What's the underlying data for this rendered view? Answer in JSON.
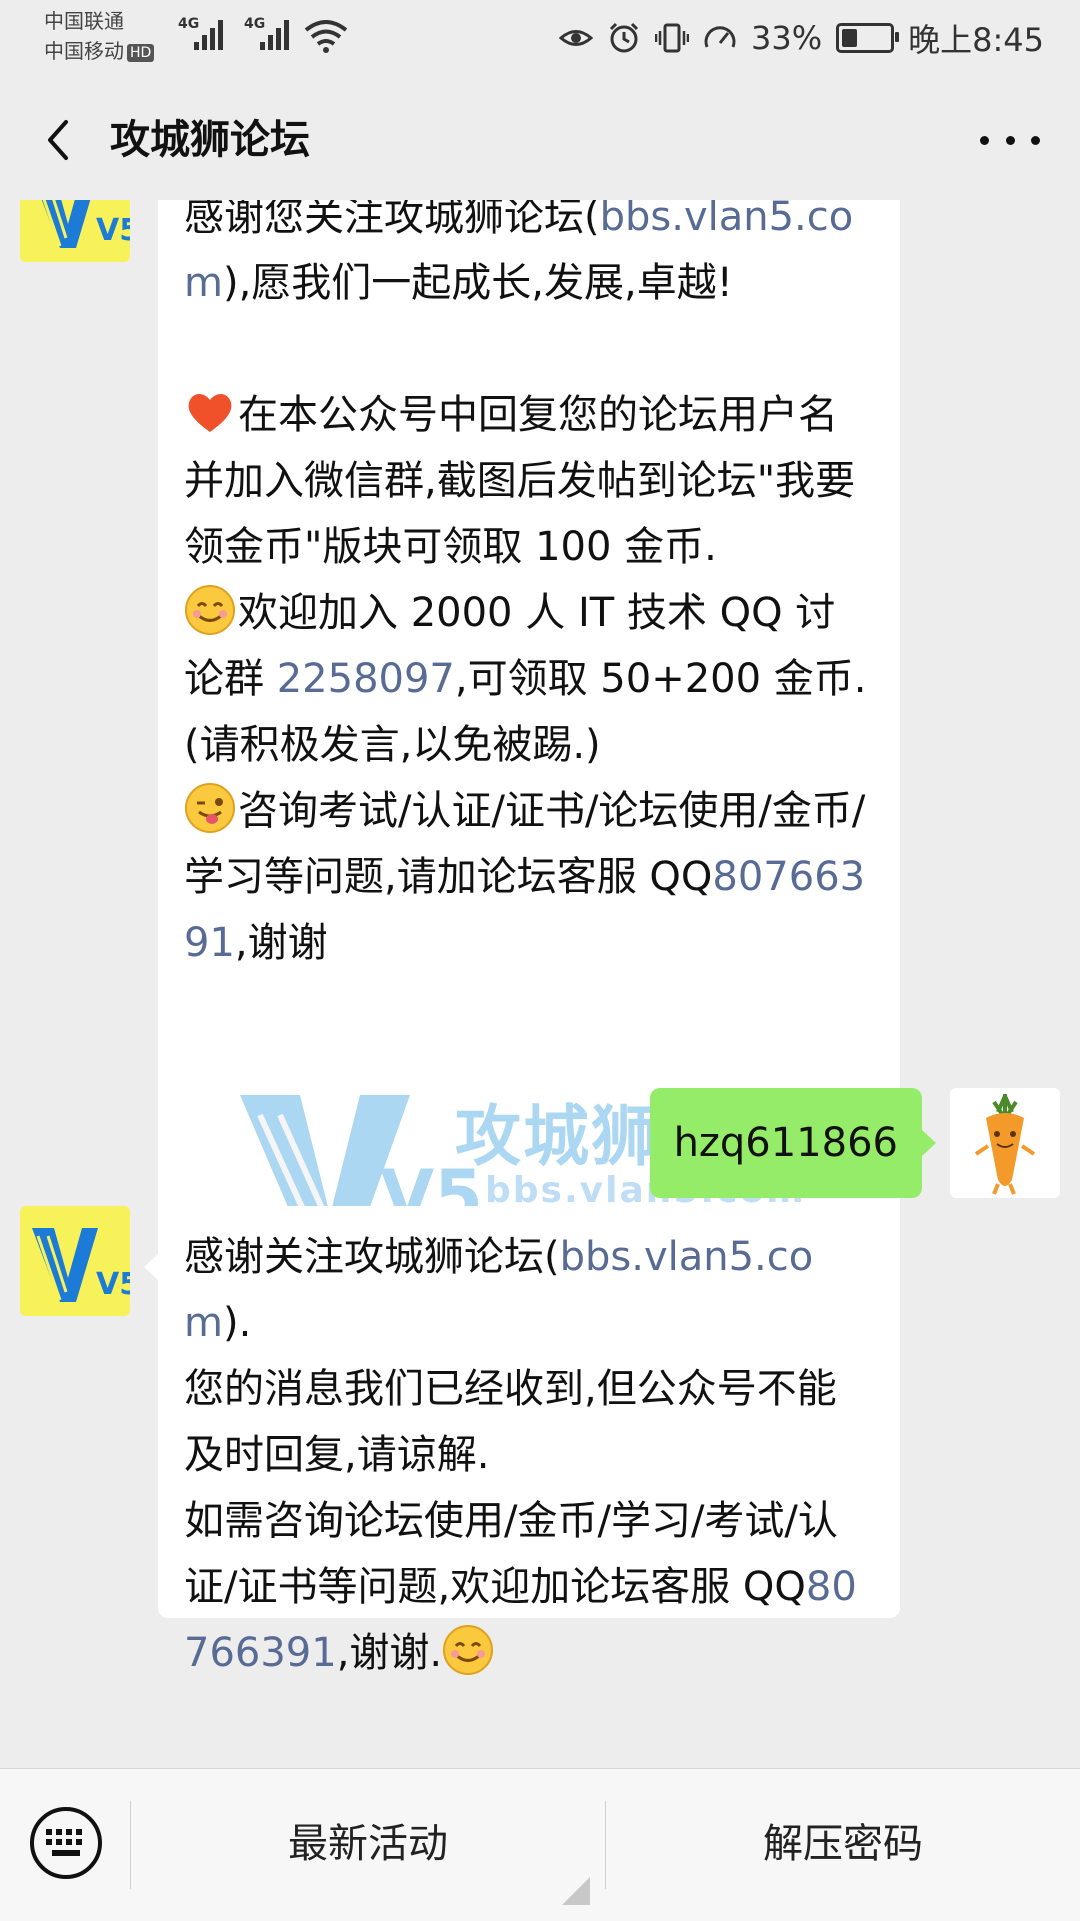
{
  "status_bar": {
    "carrier_1": "中国联通",
    "carrier_2": "中国移动",
    "hd_badge": "HD",
    "network_1": "4G",
    "network_2": "4G",
    "battery_percent": "33%",
    "battery_level": 0.33,
    "time": "晚上8:45"
  },
  "header": {
    "title": "攻城狮论坛"
  },
  "messages": {
    "m1": {
      "p1_text": "感谢您关注攻城狮论坛(",
      "p1_link": "bbs.vlan5.com",
      "p1_tail": "),愿我们一起成长,发展,卓越!",
      "p2_text": "在本公众号中回复您的论坛用户名并加入微信群,截图后发帖到论坛\"我要领金币\"版块可领取 100 金币.",
      "p3_pre": "欢迎加入 2000 人 IT 技术 QQ 讨论群 ",
      "p3_link": "2258097",
      "p3_tail": ",可领取 50+200 金币.(请积极发言,以免被踢.)",
      "p4_pre": "咨询考试/认证/证书/论坛使用/金币/学习等问题,请加论坛客服 QQ",
      "p4_link": "80766391",
      "p4_tail": ",谢谢"
    },
    "m2": {
      "text": "hzq611866"
    },
    "m3": {
      "p1_text": "感谢关注攻城狮论坛(",
      "p1_link": "bbs.vlan5.com",
      "p1_tail": ").",
      "p2_text": "您的消息我们已经收到,但公众号不能及时回复,请谅解.",
      "p3_pre": "如需咨询论坛使用/金币/学习/考试/认证/证书等问题,欢迎加论坛客服 QQ",
      "p3_link": "80766391",
      "p3_tail": ",谢谢."
    }
  },
  "watermark": {
    "logo_text": "V5",
    "name": "攻城狮论坛",
    "url": "bbs.vlan5.com"
  },
  "avatar_logo": "V5",
  "bottom_menu": {
    "item_1": "最新活动",
    "item_2": "解压密码"
  },
  "icons": {
    "back": "chevron-left-icon",
    "more": "more-dots-icon",
    "keyboard": "keyboard-icon",
    "heart": "heart-emoji",
    "smile": "smile-emoji",
    "wink": "wink-tongue-emoji"
  }
}
